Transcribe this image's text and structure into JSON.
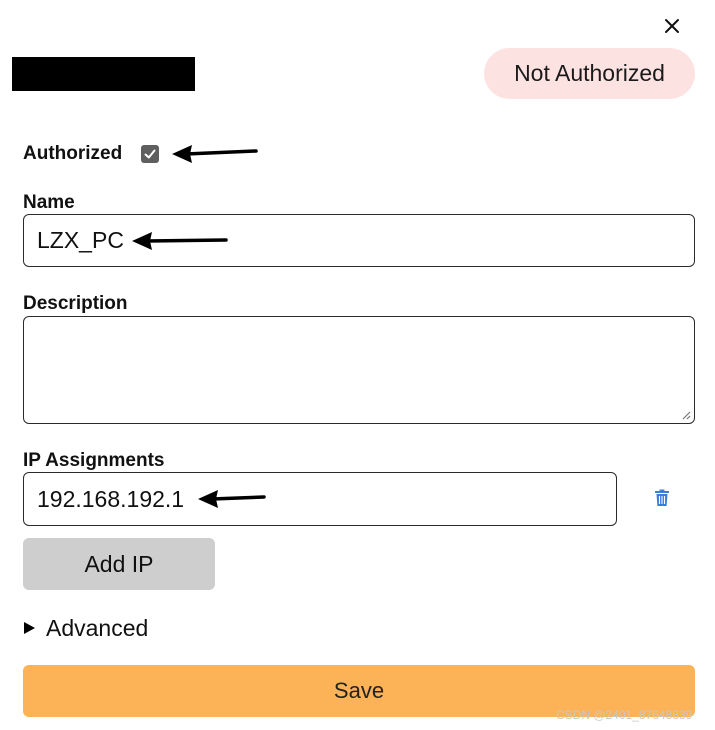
{
  "dialog": {
    "close_icon": "close-icon",
    "status_badge": "Not Authorized",
    "colors": {
      "status_bg": "#fde2e2",
      "save_bg": "#fcb257",
      "add_ip_bg": "#cecece",
      "trash_icon": "#3b7ddd"
    }
  },
  "form": {
    "authorized_label": "Authorized",
    "authorized_checked": true,
    "name_label": "Name",
    "name_value": "LZX_PC",
    "description_label": "Description",
    "description_value": "",
    "ip_label": "IP Assignments",
    "ip_value": "192.168.192.1",
    "add_ip_label": "Add IP",
    "advanced_label": "Advanced",
    "save_label": "Save",
    "trash_icon": "trash-icon"
  },
  "watermark": "CSDN @2401_87648839"
}
